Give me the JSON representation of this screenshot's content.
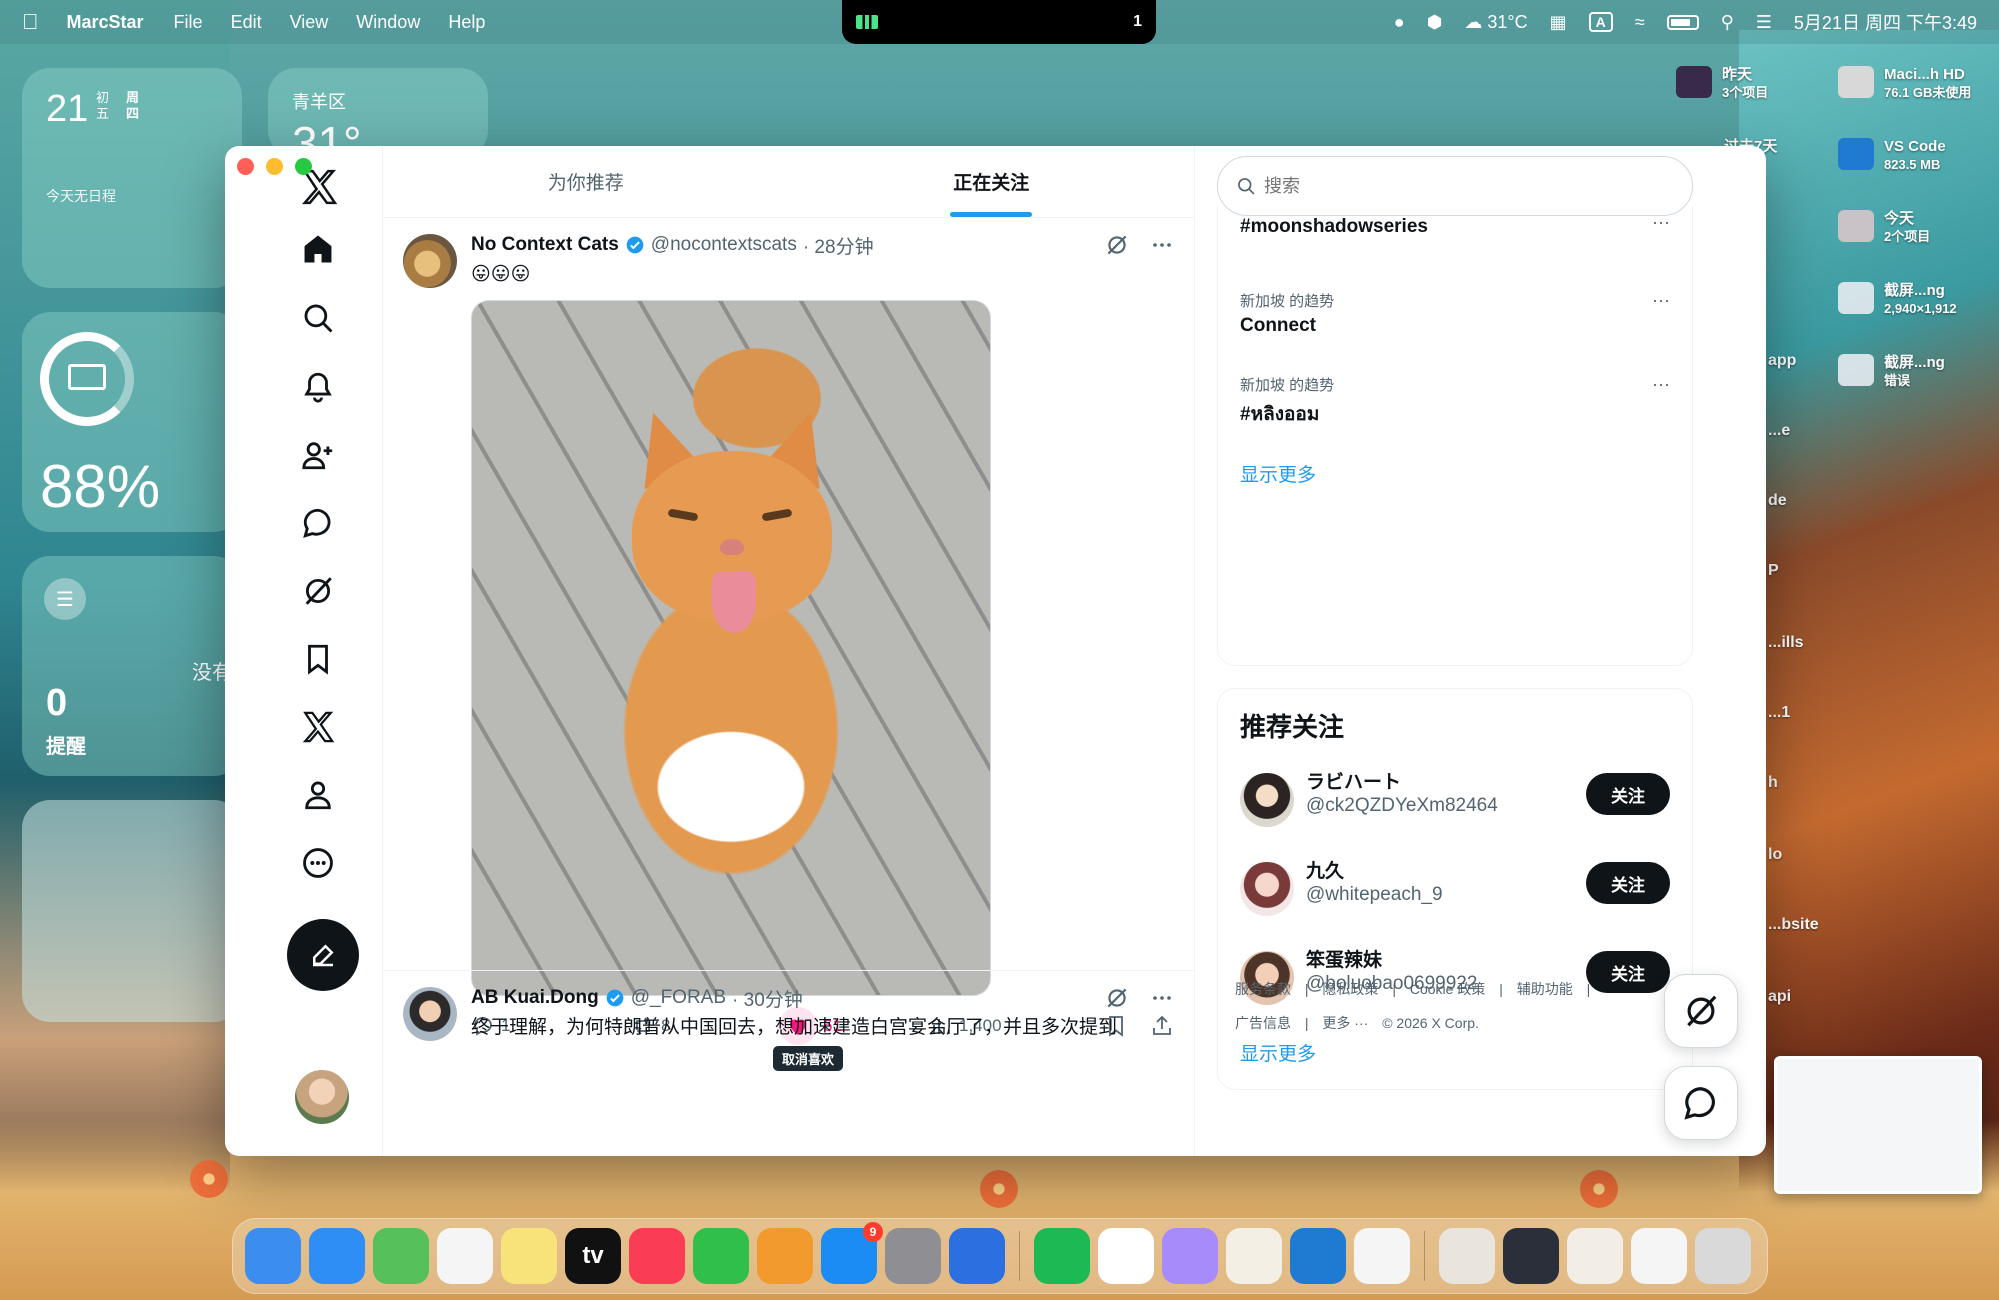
{
  "menubar": {
    "app_name": "MarcStar",
    "menus": [
      "File",
      "Edit",
      "View",
      "Window",
      "Help"
    ],
    "notch_count": "1",
    "weather": "31°C",
    "input_badge": "A",
    "datetime": "5月21日 周四 下午3:49"
  },
  "widgets": {
    "calendar": {
      "day": "21",
      "lunar": "初五",
      "weekday": "周四",
      "empty": "今天无日程"
    },
    "weather": {
      "location": "青羊区",
      "temp": "31°"
    },
    "battery": {
      "percent": "88%",
      "level": 0.88
    },
    "reminders": {
      "empty": "没有",
      "count": "0",
      "label": "提醒"
    }
  },
  "desktop_items": [
    {
      "name": "昨天",
      "sub": "3个项目"
    },
    {
      "name": "Maci...h HD",
      "sub": "76.1 GB未使用"
    },
    {
      "name": "过去7天",
      "sub": ""
    },
    {
      "name": "VS Code",
      "sub": "823.5 MB"
    },
    {
      "name": "今天",
      "sub": "2个项目"
    },
    {
      "name": "截屏...ng",
      "sub": "2,940×1,912"
    },
    {
      "name": "截屏...ng",
      "sub": "错误"
    }
  ],
  "desktop_clipped": [
    "app",
    "...e",
    "de",
    "P",
    "...ills",
    "...1",
    "h",
    "lo",
    "...bsite",
    "api"
  ],
  "x": {
    "tabs": [
      {
        "label": "为你推荐",
        "active": false
      },
      {
        "label": "正在关注",
        "active": true
      }
    ],
    "posts": [
      {
        "name": "No Context Cats",
        "handle": "@nocontextscats",
        "time": "· 28分钟",
        "text": "😛😛😛",
        "replies": "1",
        "reposts": "8",
        "likes": "61",
        "views": "1,400",
        "like_tooltip": "取消喜欢"
      },
      {
        "name": "AB Kuai.Dong",
        "handle": "@_FORAB",
        "time": "· 30分钟",
        "text": "终于理解，为何特朗普从中国回去，想加速建造白宫宴会厅了，并且多次提到"
      }
    ],
    "search_placeholder": "搜索",
    "trends": [
      {
        "meta": "新加坡 的趋势",
        "topic": "#moonshadowseries"
      },
      {
        "meta": "新加坡 的趋势",
        "topic": "Connect"
      },
      {
        "meta": "新加坡 的趋势",
        "topic": "#หลิงออม"
      }
    ],
    "show_more": "显示更多",
    "who_to_follow_title": "推荐关注",
    "suggested": [
      {
        "name": "ラビハート",
        "handle": "@ck2QZDYeXm82464",
        "button": "关注"
      },
      {
        "name": "九久",
        "handle": "@whitepeach_9",
        "button": "关注"
      },
      {
        "name": "笨蛋辣妹",
        "handle": "@boluobao0699922",
        "button": "关注"
      }
    ],
    "footer_links": [
      "服务条款",
      "|",
      "隐私政策",
      "|",
      "Cookie 政策",
      "|",
      "辅助功能",
      "|",
      "广告信息",
      "|",
      "更多 ···",
      "© 2026 X Corp."
    ]
  },
  "colors": {
    "accent": "#1d9bf0",
    "like": "#f91880",
    "text": "#0f1419",
    "muted": "#536471"
  },
  "dock": [
    {
      "icon": "finder-icon",
      "color": "#3b8ef0"
    },
    {
      "icon": "safari-icon",
      "color": "#2f8ef5"
    },
    {
      "icon": "maps-icon",
      "color": "#56c05b"
    },
    {
      "icon": "reminders-icon",
      "color": "#f5f5f5"
    },
    {
      "icon": "notes-icon",
      "color": "#f8e27a"
    },
    {
      "icon": "appletv-icon",
      "color": "#111111",
      "label": "tv"
    },
    {
      "icon": "music-icon",
      "color": "#fa3d55"
    },
    {
      "icon": "numbers-icon",
      "color": "#2fbf4a"
    },
    {
      "icon": "pages-icon",
      "color": "#f29a2e"
    },
    {
      "icon": "appstore-icon",
      "color": "#1c8cf5",
      "badge": "9"
    },
    {
      "icon": "system-settings-icon",
      "color": "#8e8e93"
    },
    {
      "icon": "xcode-icon",
      "color": "#2c6fe0"
    },
    {
      "sep": true
    },
    {
      "icon": "spotify-icon",
      "color": "#1db954"
    },
    {
      "icon": "chrome-icon",
      "color": "#ffffff"
    },
    {
      "icon": "cat-app-icon",
      "color": "#a78bfa"
    },
    {
      "icon": "terminal-icon",
      "color": "#f4efe4"
    },
    {
      "icon": "vscode-icon",
      "color": "#1f7ad1"
    },
    {
      "icon": "diff-app-icon",
      "color": "#f5f5f5"
    },
    {
      "sep": true
    },
    {
      "icon": "downloads-stack-icon",
      "color": "#e9e4dc"
    },
    {
      "icon": "window-thumb-icon",
      "color": "#2a2f3a"
    },
    {
      "icon": "window-thumb-icon",
      "color": "#f2eee6"
    },
    {
      "icon": "window-thumb-icon",
      "color": "#f5f5f5"
    },
    {
      "icon": "trash-icon",
      "color": "#d9d9d9"
    }
  ]
}
